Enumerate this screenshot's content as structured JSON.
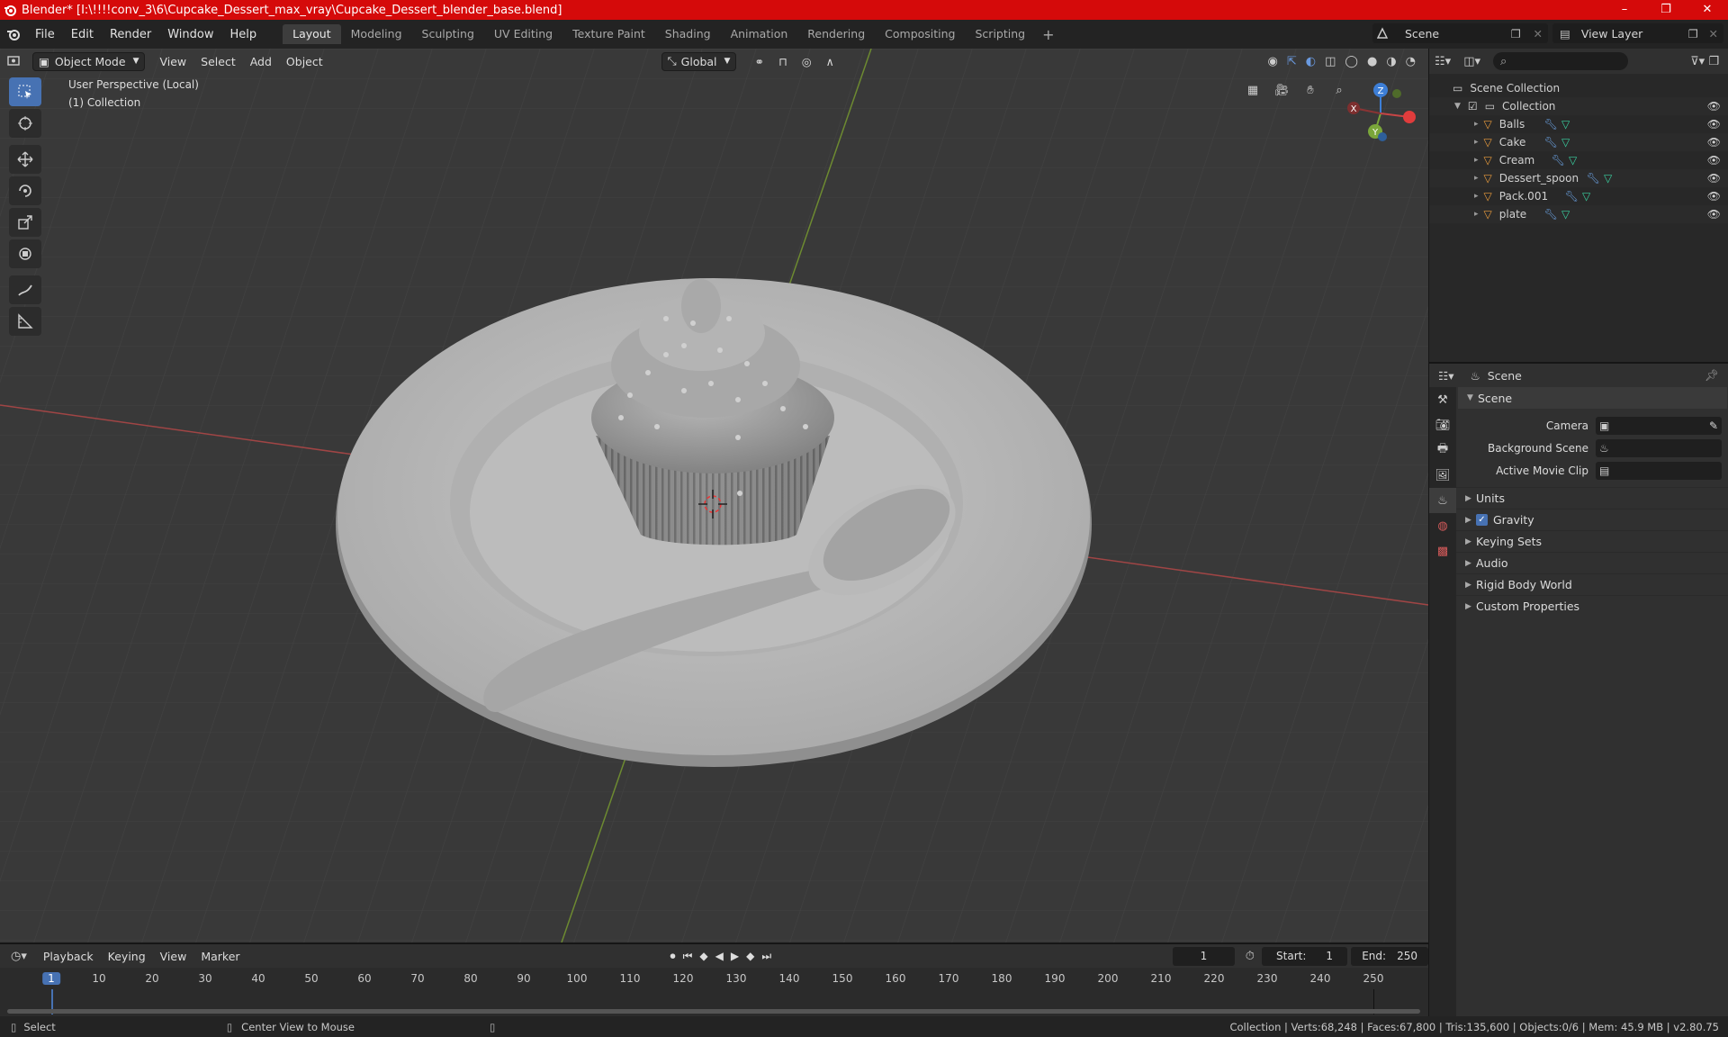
{
  "window": {
    "title": "Blender* [I:\\!!!!conv_3\\6\\Cupcake_Dessert_max_vray\\Cupcake_Dessert_blender_base.blend]",
    "min": "–",
    "max": "❐",
    "close": "✕"
  },
  "menu": [
    "File",
    "Edit",
    "Render",
    "Window",
    "Help"
  ],
  "workspaces": [
    "Layout",
    "Modeling",
    "Sculpting",
    "UV Editing",
    "Texture Paint",
    "Shading",
    "Animation",
    "Rendering",
    "Compositing",
    "Scripting"
  ],
  "workspace_plus": "+",
  "scene_name": "Scene",
  "view_layer": "View Layer",
  "viewport": {
    "mode": "Object Mode",
    "menus": [
      "View",
      "Select",
      "Add",
      "Object"
    ],
    "transform": "Global",
    "info_line1": "User Perspective (Local)",
    "info_line2": "(1) Collection",
    "gizmo": {
      "z": "Z",
      "y": "Y",
      "x": "X"
    }
  },
  "outliner": {
    "root": "Scene Collection",
    "collection": "Collection",
    "items": [
      "Balls",
      "Cake",
      "Cream",
      "Dessert_spoon",
      "Pack.001",
      "plate"
    ]
  },
  "properties": {
    "header": "Scene",
    "section": "Scene",
    "rows": [
      {
        "label": "Camera"
      },
      {
        "label": "Background Scene"
      },
      {
        "label": "Active Movie Clip"
      }
    ],
    "subsections": [
      "Units",
      "Gravity",
      "Keying Sets",
      "Audio",
      "Rigid Body World",
      "Custom Properties"
    ]
  },
  "timeline": {
    "menus": [
      "Playback",
      "Keying",
      "View",
      "Marker"
    ],
    "current_frame": "1",
    "start_label": "Start:",
    "start": "1",
    "end_label": "End:",
    "end": "250",
    "ticks": [
      "1",
      "10",
      "20",
      "30",
      "40",
      "50",
      "60",
      "70",
      "80",
      "90",
      "100",
      "110",
      "120",
      "130",
      "140",
      "150",
      "160",
      "170",
      "180",
      "190",
      "200",
      "210",
      "220",
      "230",
      "240",
      "250"
    ]
  },
  "status": {
    "select": "Select",
    "center": "Center View to Mouse",
    "stats": "Collection | Verts:68,248 | Faces:67,800 | Tris:135,600 | Objects:0/6 | Mem: 45.9 MB | v2.80.75"
  },
  "colors": {
    "title_bar": "#d50a0a",
    "active_blue": "#4772b3",
    "object_orange": "#e89b3c",
    "axis_red": "#c44b4b",
    "axis_green": "#7ea23a"
  }
}
